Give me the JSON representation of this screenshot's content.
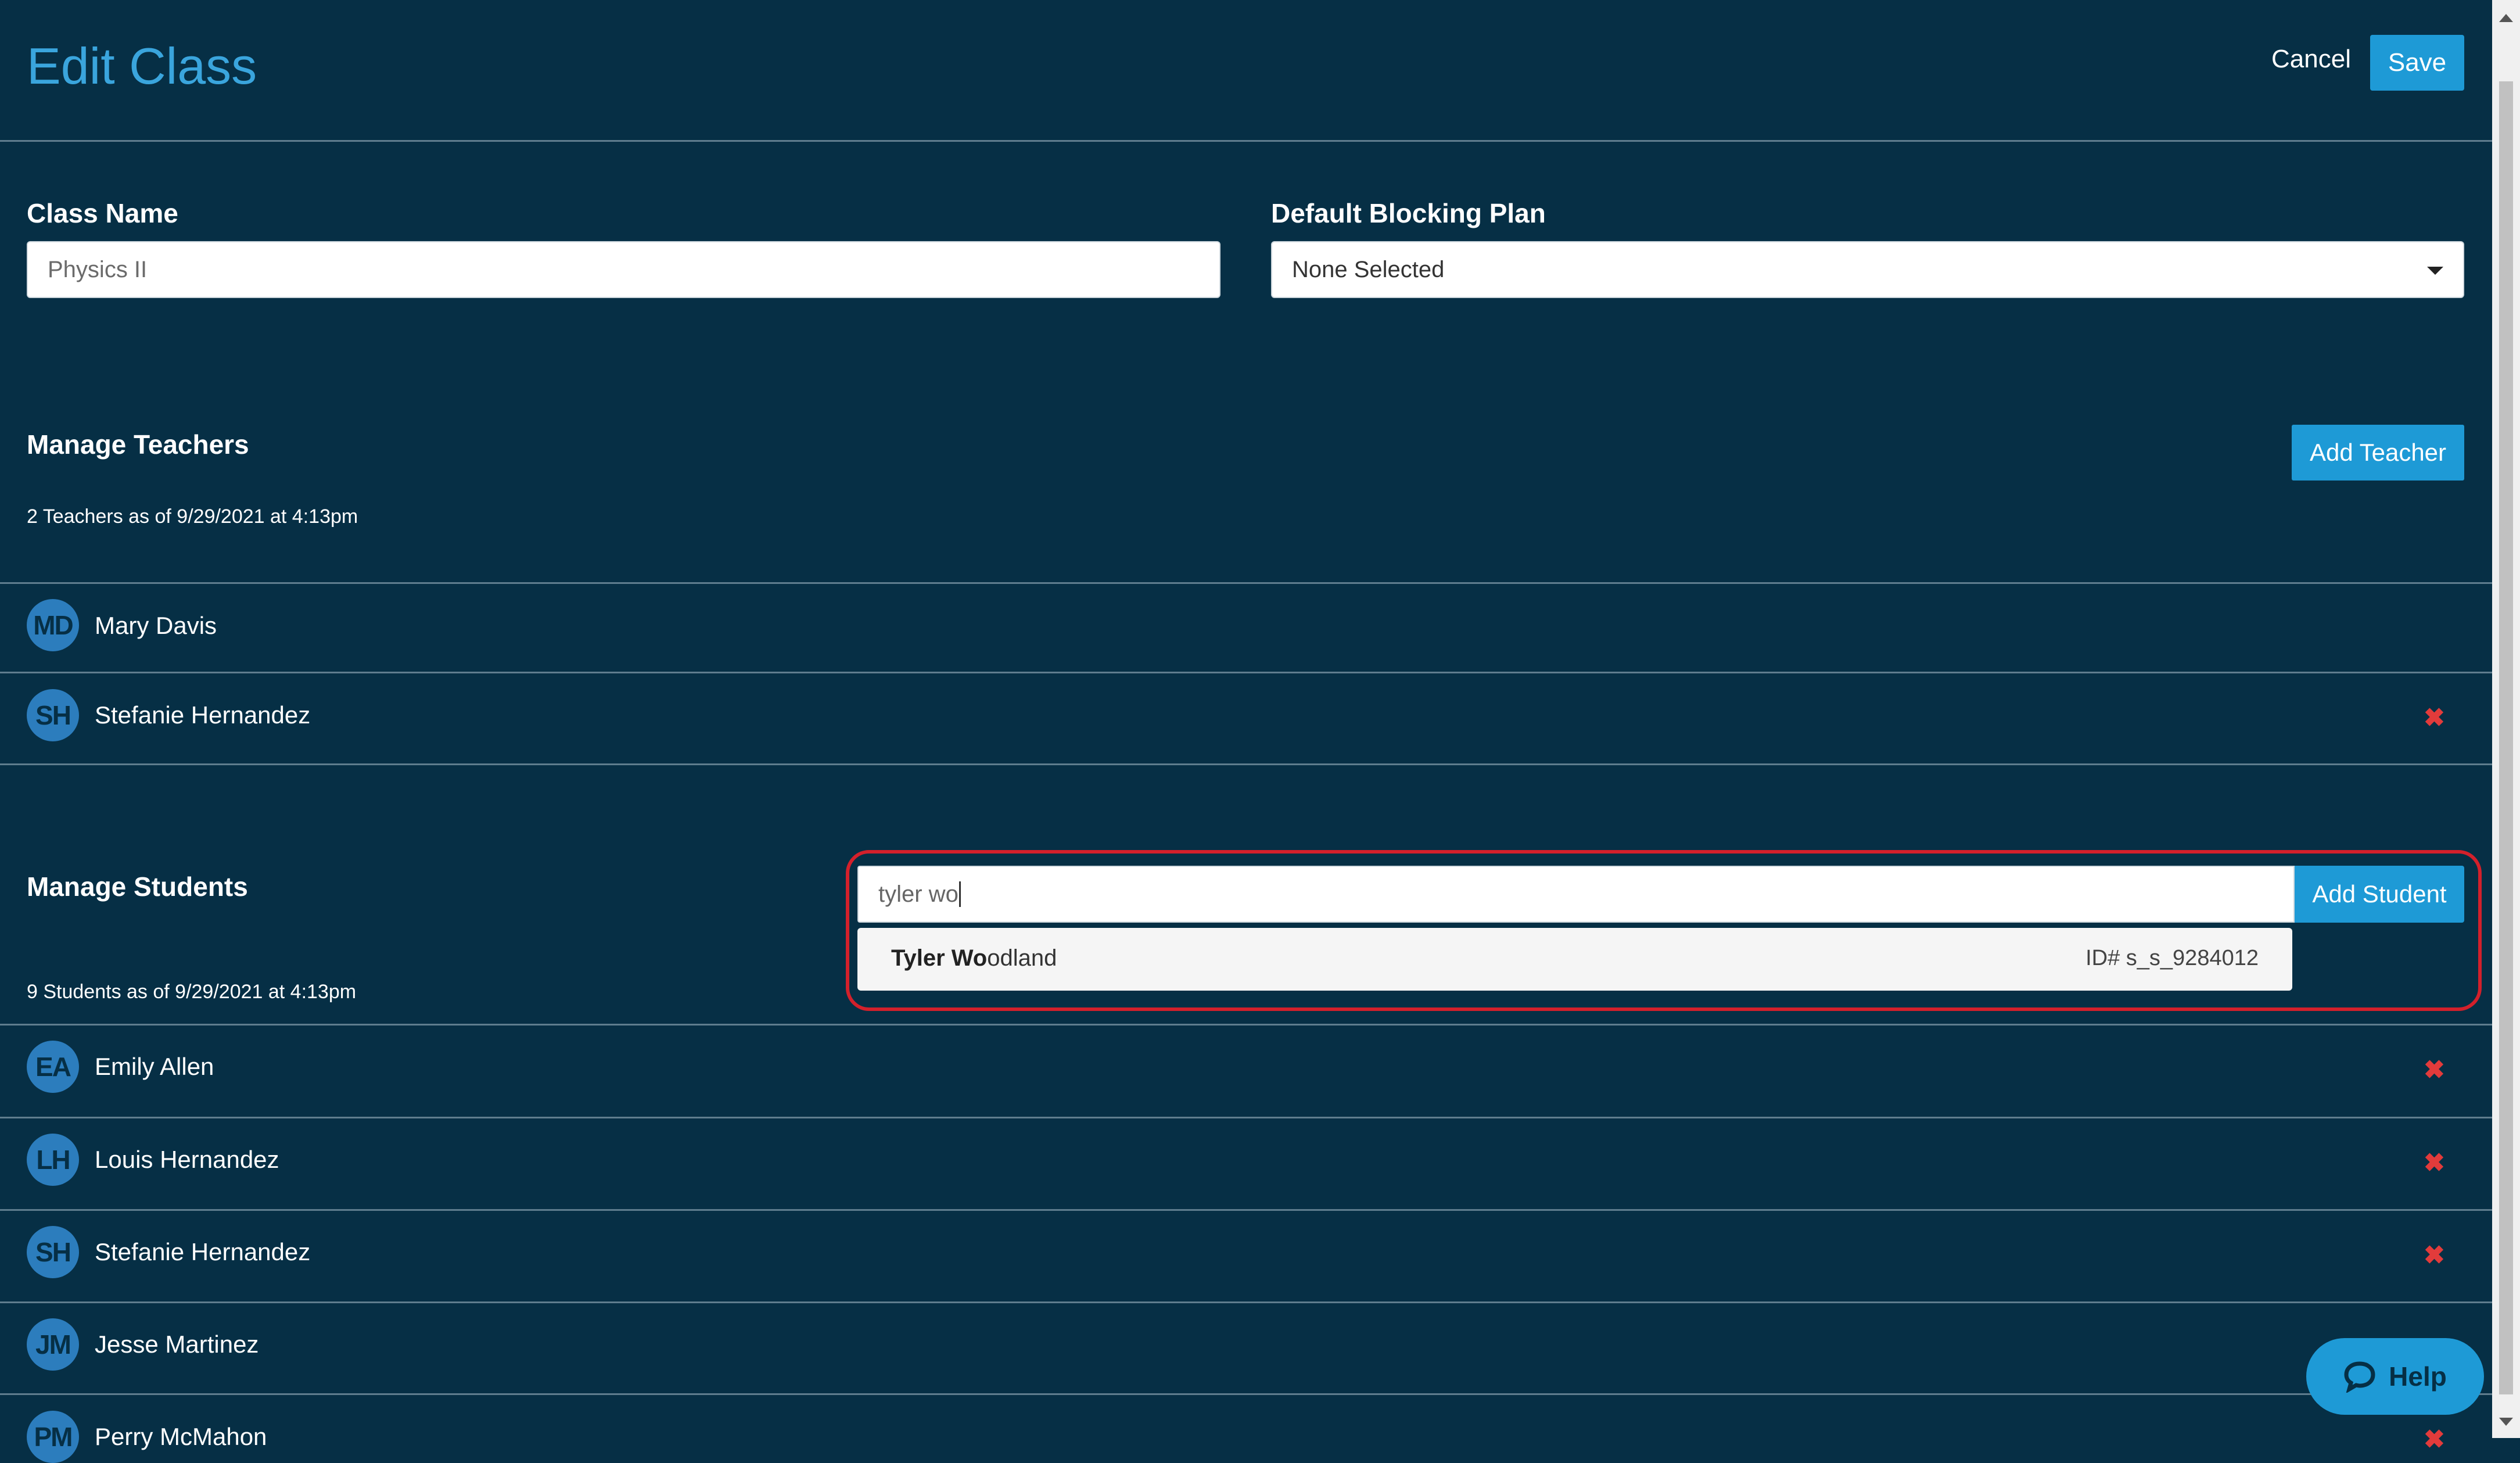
{
  "header": {
    "title": "Edit Class",
    "cancel_label": "Cancel",
    "save_label": "Save"
  },
  "form": {
    "class_name": {
      "label": "Class Name",
      "value": "Physics II"
    },
    "blocking_plan": {
      "label": "Default Blocking Plan",
      "selected": "None Selected"
    }
  },
  "teachers": {
    "heading": "Manage Teachers",
    "add_label": "Add Teacher",
    "meta": "2 Teachers as of 9/29/2021 at 4:13pm",
    "items": [
      {
        "initials": "MD",
        "name": "Mary Davis",
        "removable": false
      },
      {
        "initials": "SH",
        "name": "Stefanie Hernandez",
        "removable": true
      }
    ]
  },
  "students": {
    "heading": "Manage Students",
    "add_label": "Add Student",
    "meta": "9 Students as of 9/29/2021 at 4:13pm",
    "search": {
      "value": "tyler wo",
      "suggestion": {
        "match": "Tyler Wo",
        "rest": "odland",
        "id": "ID# s_s_9284012"
      }
    },
    "items": [
      {
        "initials": "EA",
        "name": "Emily Allen"
      },
      {
        "initials": "LH",
        "name": "Louis Hernandez"
      },
      {
        "initials": "SH",
        "name": "Stefanie Hernandez"
      },
      {
        "initials": "JM",
        "name": "Jesse Martinez"
      },
      {
        "initials": "PM",
        "name": "Perry McMahon"
      }
    ]
  },
  "help": {
    "label": "Help",
    "icon": "chat-bubble-icon"
  },
  "colors": {
    "background": "#062f45",
    "accent": "#1e9ad6",
    "title": "#3aa5dd",
    "remove": "#e23b3b",
    "highlight": "#d3202b"
  }
}
